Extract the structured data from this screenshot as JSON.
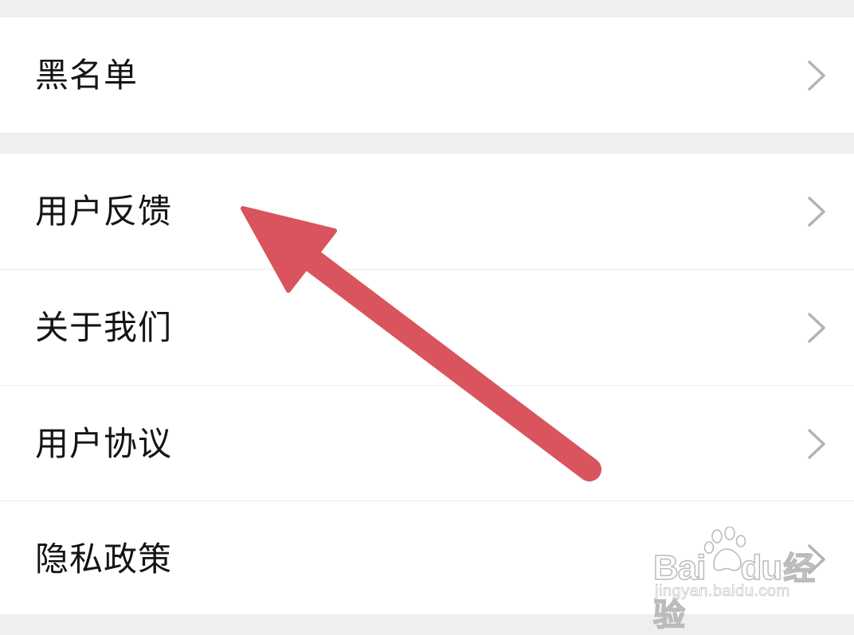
{
  "menu": {
    "blacklist_label": "黑名单",
    "feedback_label": "用户反馈",
    "about_label": "关于我们",
    "agreement_label": "用户协议",
    "privacy_label": "隐私政策"
  },
  "watermark": {
    "brand": "Bai",
    "brand2": "du",
    "brand_cn": "经验",
    "url": "jingyan.baidu.com"
  },
  "icons": {
    "row_chevron": "chevron-right-icon",
    "annotation": "arrow-annotation"
  },
  "colors": {
    "background": "#efefef",
    "row": "#ffffff",
    "text": "#141414",
    "chevron": "#b3b3b3",
    "arrow": "#d9545c"
  }
}
